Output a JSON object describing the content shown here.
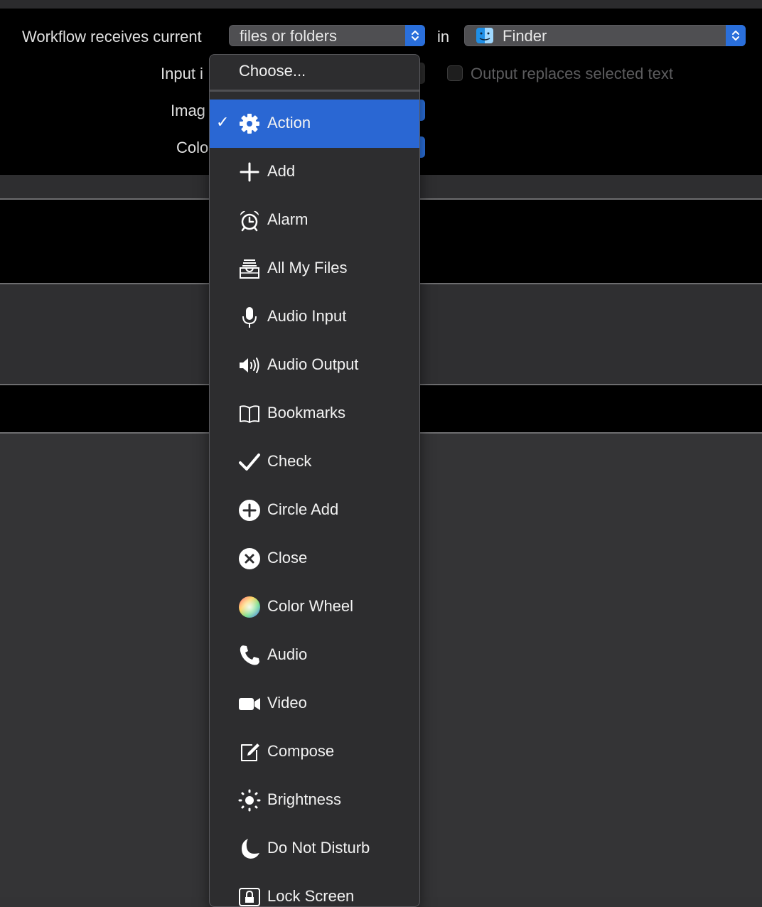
{
  "header": {
    "receives_label": "Workflow receives current",
    "receives_value": "files or folders",
    "in_label": "in",
    "app_value": "Finder",
    "input_label": "Input i",
    "output_replaces_label": "Output replaces selected text",
    "image_label": "Imag",
    "color_label": "Colo"
  },
  "menu": {
    "choose_label": "Choose...",
    "items": [
      {
        "label": "Action",
        "icon": "gear-icon",
        "selected": true
      },
      {
        "label": "Add",
        "icon": "plus-icon"
      },
      {
        "label": "Alarm",
        "icon": "alarm-clock-icon"
      },
      {
        "label": "All My Files",
        "icon": "file-tray-icon"
      },
      {
        "label": "Audio Input",
        "icon": "microphone-icon"
      },
      {
        "label": "Audio Output",
        "icon": "speaker-icon"
      },
      {
        "label": "Bookmarks",
        "icon": "open-book-icon"
      },
      {
        "label": "Check",
        "icon": "checkmark-icon"
      },
      {
        "label": "Circle Add",
        "icon": "circle-plus-icon"
      },
      {
        "label": "Close",
        "icon": "circle-x-icon"
      },
      {
        "label": "Color Wheel",
        "icon": "color-wheel-icon"
      },
      {
        "label": "Audio",
        "icon": "phone-icon"
      },
      {
        "label": "Video",
        "icon": "video-camera-icon"
      },
      {
        "label": "Compose",
        "icon": "compose-icon"
      },
      {
        "label": "Brightness",
        "icon": "sun-icon"
      },
      {
        "label": "Do Not Disturb",
        "icon": "moon-icon"
      },
      {
        "label": "Lock Screen",
        "icon": "lock-icon"
      }
    ]
  },
  "colors": {
    "accent": "#2a67d3",
    "menu_bg": "#2d2d2f",
    "header_bg": "#000000"
  }
}
